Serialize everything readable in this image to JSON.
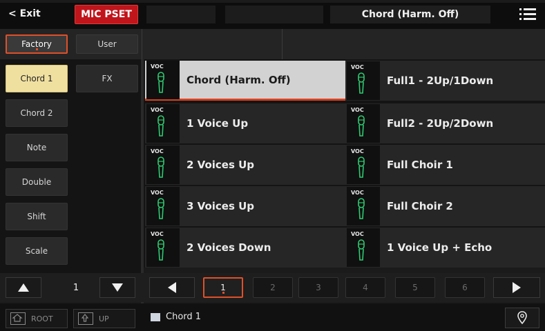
{
  "topbar": {
    "exit_label": "< Exit",
    "mode_label": "MIC PSET",
    "current_preset": "Chord (Harm. Off)",
    "menu_icon": "list-menu-icon"
  },
  "banks": [
    {
      "label": "Factory",
      "selected": true
    },
    {
      "label": "User",
      "selected": false
    }
  ],
  "categories": [
    {
      "label": "Chord 1",
      "selected": true
    },
    {
      "label": "FX",
      "selected": false
    },
    {
      "label": "Chord 2",
      "selected": false
    },
    {
      "label": "Note",
      "selected": false
    },
    {
      "label": "Double",
      "selected": false
    },
    {
      "label": "Shift",
      "selected": false
    },
    {
      "label": "Scale",
      "selected": false
    }
  ],
  "category_page": "1",
  "presets": [
    {
      "tag": "VOC",
      "name": "Chord (Harm. Off)",
      "selected": true
    },
    {
      "tag": "VOC",
      "name": "Full1 - 2Up/1Down",
      "selected": false
    },
    {
      "tag": "VOC",
      "name": "1 Voice Up",
      "selected": false
    },
    {
      "tag": "VOC",
      "name": "Full2 - 2Up/2Down",
      "selected": false
    },
    {
      "tag": "VOC",
      "name": "2 Voices Up",
      "selected": false
    },
    {
      "tag": "VOC",
      "name": "Full Choir 1",
      "selected": false
    },
    {
      "tag": "VOC",
      "name": "3 Voices Up",
      "selected": false
    },
    {
      "tag": "VOC",
      "name": "Full Choir 2",
      "selected": false
    },
    {
      "tag": "VOC",
      "name": "2 Voices Down",
      "selected": false
    },
    {
      "tag": "VOC",
      "name": "1 Voice Up + Echo",
      "selected": false
    }
  ],
  "pages": [
    "1",
    "2",
    "3",
    "4",
    "5",
    "6"
  ],
  "selected_page": "1",
  "footer": {
    "root_label": "ROOT",
    "up_label": "UP",
    "path": "Chord 1"
  },
  "colors": {
    "accent": "#e0502a",
    "mode_red": "#c0151b",
    "selected_category": "#f0e0a0",
    "mic_green": "#2ecc71"
  }
}
